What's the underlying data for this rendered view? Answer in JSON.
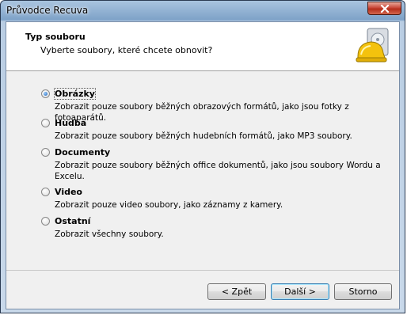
{
  "window": {
    "title": "Průvodce Recuva"
  },
  "header": {
    "title": "Typ souboru",
    "subtitle": "Vyberte soubory, které chcete obnovit?"
  },
  "options": [
    {
      "label": "Obrázky",
      "desc": "Zobrazit pouze soubory běžných obrazových formátů, jako jsou fotky z fotoaparátů.",
      "checked": true
    },
    {
      "label": "Hudba",
      "desc": "Zobrazit pouze soubory běžných hudebních formátů, jako MP3 soubory.",
      "checked": false
    },
    {
      "label": "Documenty",
      "desc": "Zobrazit pouze soubory běžných office dokumentů, jako jsou soubory Wordu a Excelu.",
      "checked": false
    },
    {
      "label": "Video",
      "desc": "Zobrazit pouze video soubory, jako záznamy z kamery.",
      "checked": false
    },
    {
      "label": "Ostatní",
      "desc": "Zobrazit všechny soubory.",
      "checked": false
    }
  ],
  "buttons": {
    "back": "< Zpět",
    "next": "Další >",
    "cancel": "Storno"
  },
  "icons": {
    "close": "close-icon",
    "logo": "recuva-logo-icon"
  }
}
